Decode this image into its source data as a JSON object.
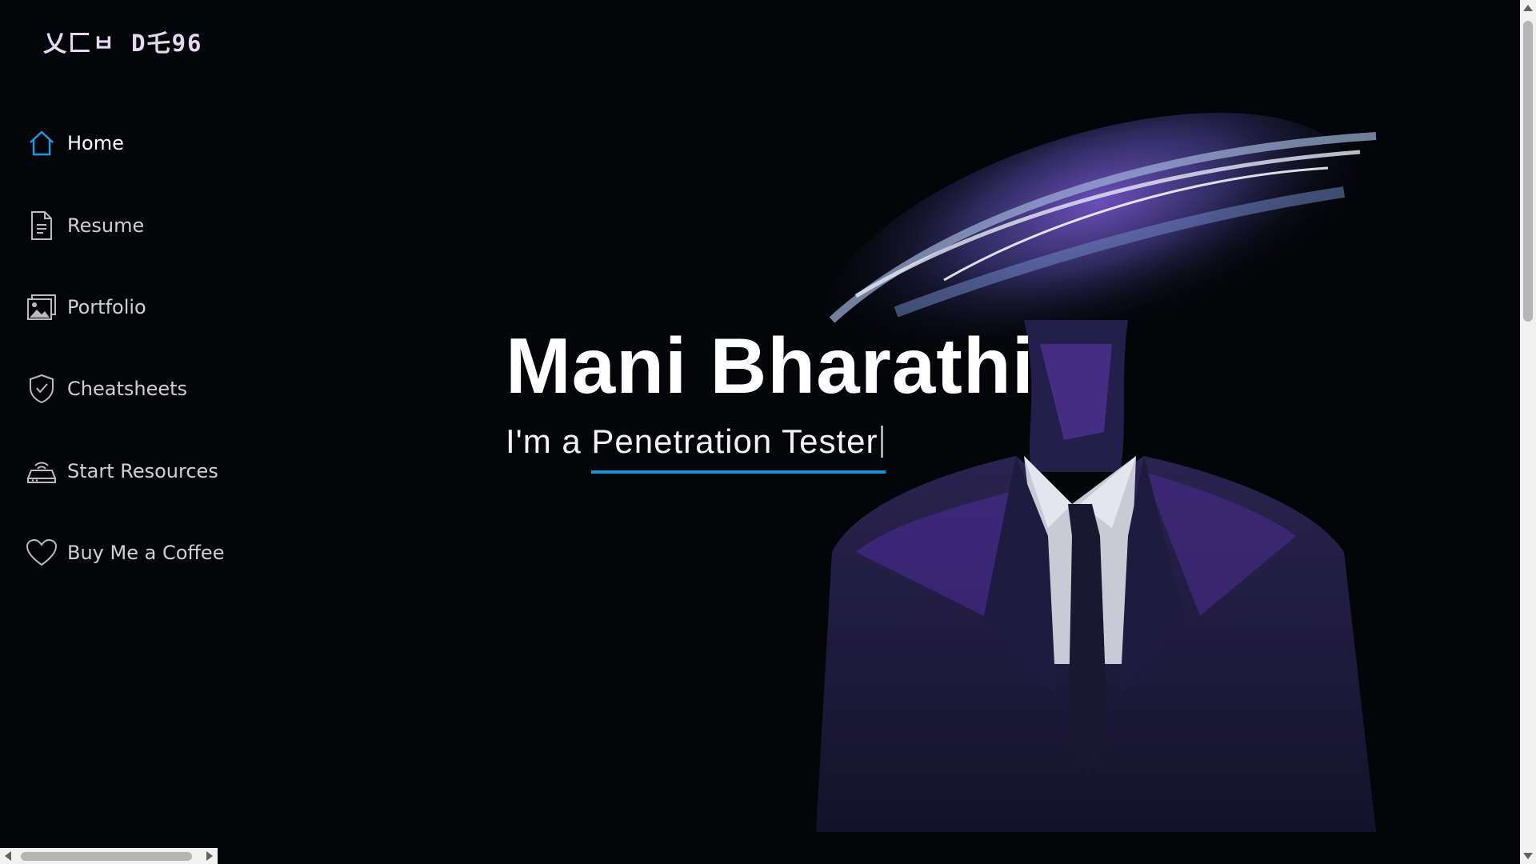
{
  "logo": {
    "text": "乂匚ㅂ D乇96"
  },
  "nav": {
    "items": [
      {
        "label": "Home",
        "icon": "home-icon",
        "active": true
      },
      {
        "label": "Resume",
        "icon": "document-icon",
        "active": false
      },
      {
        "label": "Portfolio",
        "icon": "image-gallery-icon",
        "active": false
      },
      {
        "label": "Cheatsheets",
        "icon": "shield-check-icon",
        "active": false
      },
      {
        "label": "Start Resources",
        "icon": "router-icon",
        "active": false
      },
      {
        "label": "Buy Me a Coffee",
        "icon": "heart-icon",
        "active": false
      }
    ]
  },
  "hero": {
    "name": "Mani Bharathi",
    "prefix": "I'm a",
    "typed": "Penetration Tester",
    "image": "abstract-suited-figure-image"
  },
  "colors": {
    "background": "#040509",
    "accent": "#1e90d6",
    "logo": "#e6d8f0",
    "art_purple": "#4b2a8f"
  }
}
